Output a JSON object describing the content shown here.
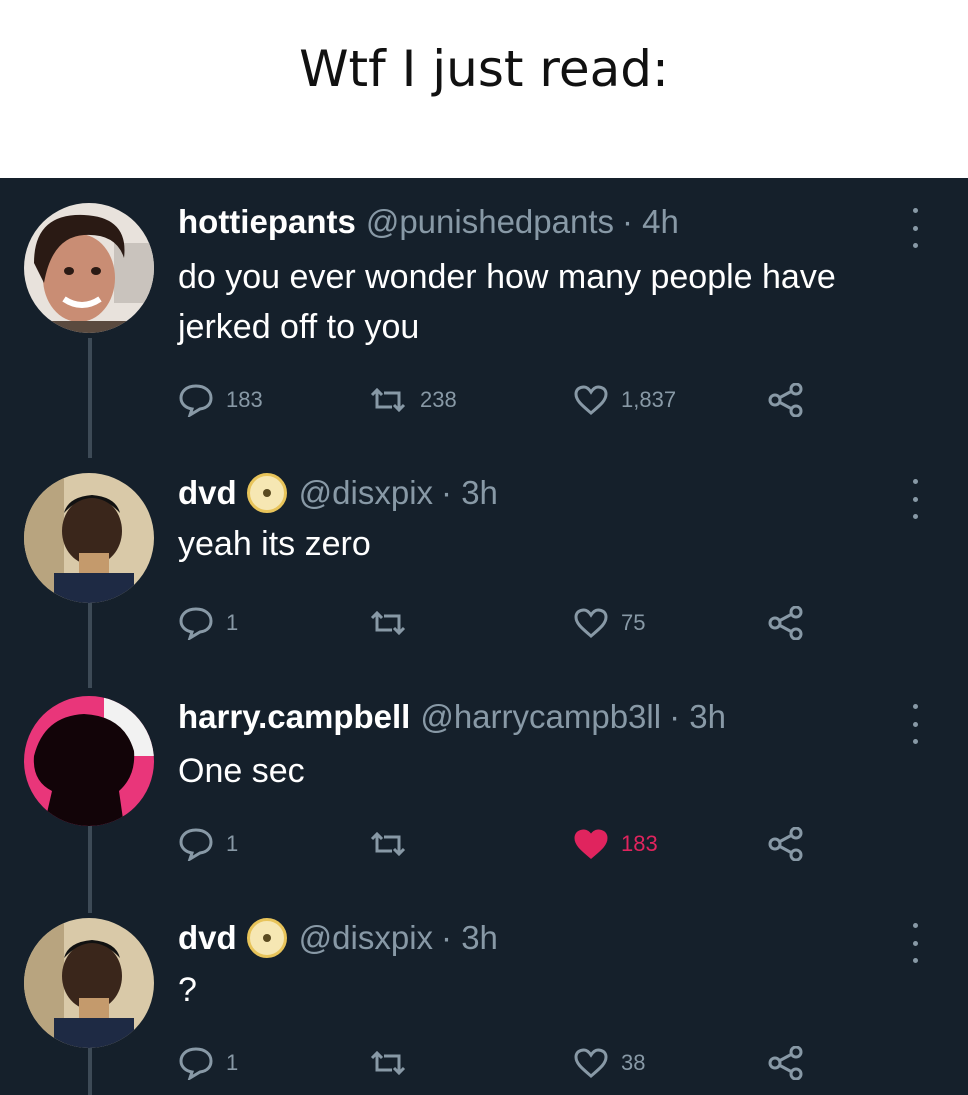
{
  "caption": "Wtf I just read:",
  "colors": {
    "background": "#15202b",
    "text_primary": "#ffffff",
    "text_secondary": "#8899a6",
    "like_active": "#e0245e",
    "caption_background": "#ffffff"
  },
  "tweets": [
    {
      "display_name": "hottiepants",
      "handle": "@punishedpants",
      "time": "· 4h",
      "verified_badge": false,
      "text": "do you ever wonder how many people have jerked off to you",
      "replies": "183",
      "retweets": "238",
      "likes": "1,837",
      "liked": false,
      "avatar": "person-photo"
    },
    {
      "display_name": "dvd",
      "handle": "@disxpix",
      "time": "· 3h",
      "verified_badge": true,
      "text": "yeah its zero",
      "replies": "1",
      "retweets": "",
      "likes": "75",
      "liked": false,
      "avatar": "person-photo"
    },
    {
      "display_name": "harry.campbell",
      "handle": "@harrycampb3ll",
      "time": "· 3h",
      "verified_badge": false,
      "text": "One sec",
      "replies": "1",
      "retweets": "",
      "likes": "183",
      "liked": true,
      "avatar": "pink-silhouette"
    },
    {
      "display_name": "dvd",
      "handle": "@disxpix",
      "time": "· 3h",
      "verified_badge": true,
      "text": "?",
      "replies": "1",
      "retweets": "",
      "likes": "38",
      "liked": false,
      "avatar": "person-photo"
    }
  ],
  "icons": {
    "reply": "reply-icon",
    "retweet": "retweet-icon",
    "like": "heart-icon",
    "share": "share-icon",
    "more": "more-options-icon",
    "badge": "badge-icon"
  }
}
